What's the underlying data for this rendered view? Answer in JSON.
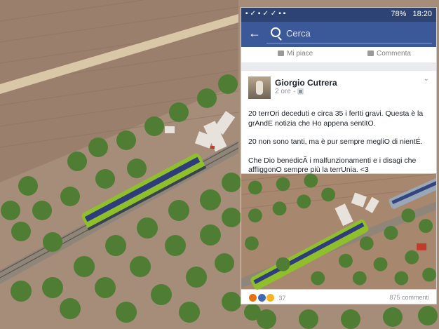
{
  "status_bar": {
    "battery": "78%",
    "time": "18:20"
  },
  "facebook": {
    "search_placeholder": "Cerca",
    "actions": {
      "like": "Mi piace",
      "comment": "Commenta"
    }
  },
  "post": {
    "author": "Giorgio Cutrera",
    "time": "2 ore",
    "text_lines": [
      "20 terrOri deceduti e circa 35 i ferIti gravi. Questa è la grAndE notizia che Ho appena sentitO.",
      "20 non sono tanti, ma è pur sempre megliO di nientÉ.",
      "Che Dio benedicÃ i malfunzionamenti e i disagi che affliggonO sempre più la terrUnia. <3"
    ],
    "reactions_count": "37",
    "comments_count": "875 commenti"
  },
  "colors": {
    "facebook_blue": "#3b5998",
    "status_bar": "#2d4373",
    "train_body": "#8fbf2a",
    "train_windows": "#2e3b7c",
    "field": "#a7846c",
    "olive_tree": "#4f7d33"
  }
}
